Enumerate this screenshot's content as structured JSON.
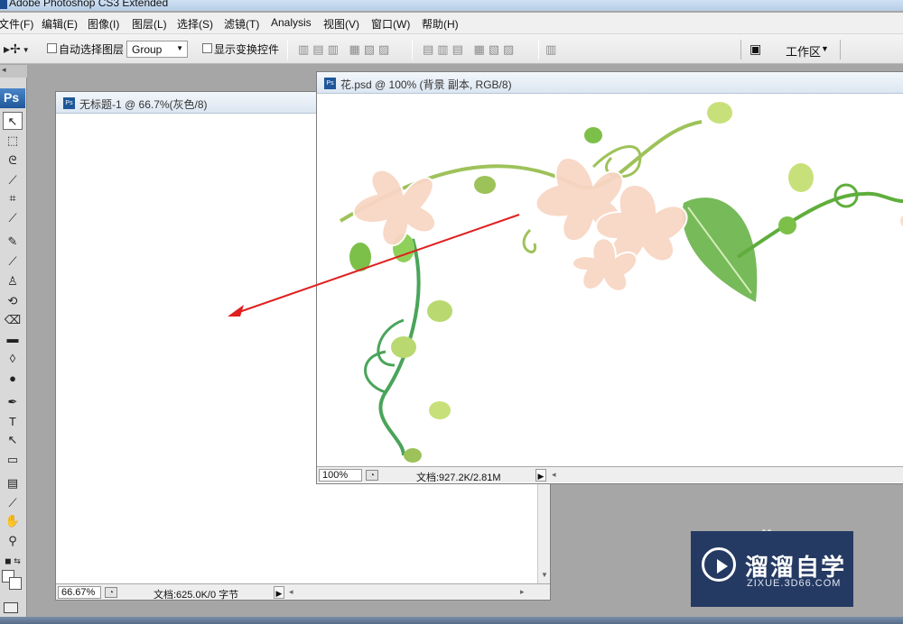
{
  "app": {
    "title": "Adobe Photoshop CS3 Extended"
  },
  "menu": [
    "文件(F)",
    "编辑(E)",
    "图像(I)",
    "图层(L)",
    "选择(S)",
    "滤镜(T)",
    "Analysis",
    "视图(V)",
    "窗口(W)",
    "帮助(H)"
  ],
  "options": {
    "auto_select_label": "自动选择图层",
    "group_value": "Group",
    "show_transform_label": "显示变换控件",
    "workspace_label": "工作区"
  },
  "toolbox": {
    "logo": "Ps",
    "tools": [
      "move-icon",
      "marquee-icon",
      "lasso-icon",
      "quick-selection-icon",
      "crop-icon",
      "eyedropper-icon",
      "healing-brush-icon",
      "brush-icon",
      "clone-stamp-icon",
      "history-brush-icon",
      "eraser-icon",
      "gradient-icon",
      "blur-icon",
      "dodge-icon",
      "pen-icon",
      "type-icon",
      "path-selection-icon",
      "rectangle-icon",
      "notes-icon",
      "color-sampler-icon",
      "hand-icon",
      "zoom-icon"
    ],
    "type_tool_glyph": "T"
  },
  "doc_untitled": {
    "title": "无标题-1 @ 66.7%(灰色/8)",
    "zoom": "66.67%",
    "info": "文档:625.0K/0 字节"
  },
  "doc_flower": {
    "title": "花.psd @ 100% (背景 副本, RGB/8)",
    "zoom": "100%",
    "info": "文档:927.2K/2.81M"
  },
  "watermark": {
    "main": "溜溜自学",
    "sub": "ZIXUE.3D66.COM"
  },
  "colors": {
    "arrow": "#e02020",
    "petal": "#f8d6c4",
    "leaf": "#5fae3c",
    "stem": "#4aa45a",
    "watermark_bg": "#253a63"
  }
}
